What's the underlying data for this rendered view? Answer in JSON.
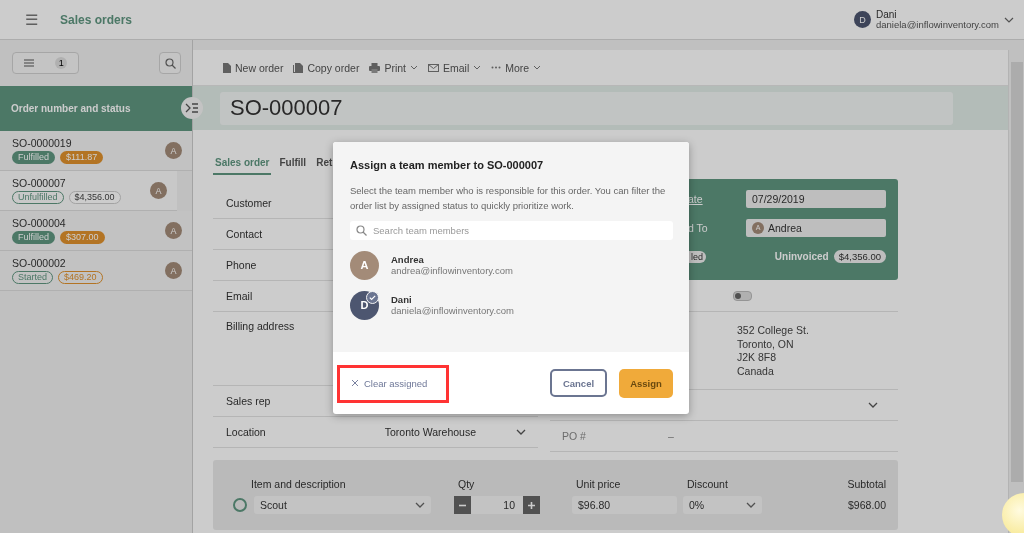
{
  "header": {
    "menu": "☰",
    "title": "Sales orders",
    "user": {
      "initial": "D",
      "name": "Dani",
      "email": "daniela@inflowinventory.com"
    }
  },
  "sidebar": {
    "filter_count": "1",
    "column_title": "Order number and status",
    "orders": [
      {
        "number": "SO-0000019",
        "badges": [
          {
            "text": "Fulfilled",
            "kind": "green"
          },
          {
            "text": "$111.87",
            "kind": "orange"
          }
        ],
        "assignee": "A",
        "selected": false
      },
      {
        "number": "SO-000007",
        "badges": [
          {
            "text": "Unfulfilled",
            "kind": "green-outline"
          },
          {
            "text": "$4,356.00",
            "kind": "grey-outline"
          }
        ],
        "assignee": "A",
        "selected": true
      },
      {
        "number": "SO-000004",
        "badges": [
          {
            "text": "Fulfilled",
            "kind": "green"
          },
          {
            "text": "$307.00",
            "kind": "orange"
          }
        ],
        "assignee": "A",
        "selected": false
      },
      {
        "number": "SO-000002",
        "badges": [
          {
            "text": "Started",
            "kind": "green-outline"
          },
          {
            "text": "$469.20",
            "kind": "orange-outline"
          }
        ],
        "assignee": "A",
        "selected": false
      }
    ]
  },
  "toolbar": [
    {
      "label": "New order",
      "menu": false
    },
    {
      "label": "Copy order",
      "menu": false
    },
    {
      "label": "Print",
      "menu": true
    },
    {
      "label": "Email",
      "menu": true
    },
    {
      "label": "More",
      "menu": true
    }
  ],
  "order_title": "SO-000007",
  "tabs": [
    {
      "label": "Sales order",
      "selected": true
    },
    {
      "label": "Fulfill",
      "selected": false
    },
    {
      "label": "Ret",
      "selected": false
    }
  ],
  "fields": [
    {
      "label": "Customer"
    },
    {
      "label": "Contact"
    },
    {
      "label": "Phone"
    },
    {
      "label": "Email"
    },
    {
      "label": "Billing address"
    },
    {
      "label": "Sales rep"
    },
    {
      "label": "Location",
      "value": "Toronto Warehouse"
    }
  ],
  "summary": {
    "date_label": "ate",
    "date": "07/29/2019",
    "assigned_label": "d To",
    "assigned_initial": "A",
    "assigned": "Andrea",
    "status_badge": "led",
    "invoice_label": "Uninvoiced",
    "invoice_amount": "$4,356.00"
  },
  "billing_toggle": {
    "on": false
  },
  "address": [
    "352 College St.",
    "Toronto, ON",
    "J2K 8F8",
    "Canada"
  ],
  "po": {
    "label": "PO #",
    "value": "–"
  },
  "line_items": {
    "columns": [
      "Item and description",
      "Qty",
      "Unit price",
      "Discount",
      "Subtotal"
    ],
    "rows": [
      {
        "checked": false,
        "item": "Scout",
        "qty": "10",
        "unit_price": "$96.80",
        "discount": "0%",
        "subtotal": "$968.00"
      }
    ]
  },
  "dialog": {
    "title": "Assign a team member to SO-000007",
    "description": "Select the team member who is responsible for this order. You can filter the order list by assigned status to quickly prioritize work.",
    "search_placeholder": "Search team members",
    "members": [
      {
        "initial": "A",
        "name": "Andrea",
        "email": "andrea@inflowinventory.com",
        "color": "#a38b78",
        "selected": false
      },
      {
        "initial": "D",
        "name": "Dani",
        "email": "daniela@inflowinventory.com",
        "color": "#4d5670",
        "selected": true
      }
    ],
    "clear": "Clear assigned",
    "cancel": "Cancel",
    "assign": "Assign"
  }
}
